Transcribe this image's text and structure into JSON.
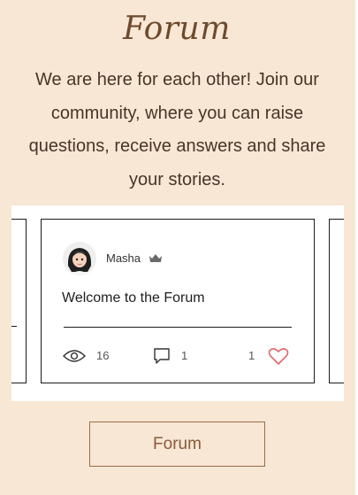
{
  "page": {
    "title": "Forum",
    "intro": "We are here for each other! Join our community, where you can raise questions, receive answers and share your stories."
  },
  "post": {
    "author": "Masha",
    "author_badge": "crown-icon",
    "title": "Welcome to the Forum",
    "views": "16",
    "comments": "1",
    "likes": "1"
  },
  "cta": {
    "label": "Forum"
  },
  "colors": {
    "background": "#f7e7d4",
    "title": "#6e4a2c",
    "button_border": "#a16a4a",
    "like_heart": "#e06b6b"
  }
}
